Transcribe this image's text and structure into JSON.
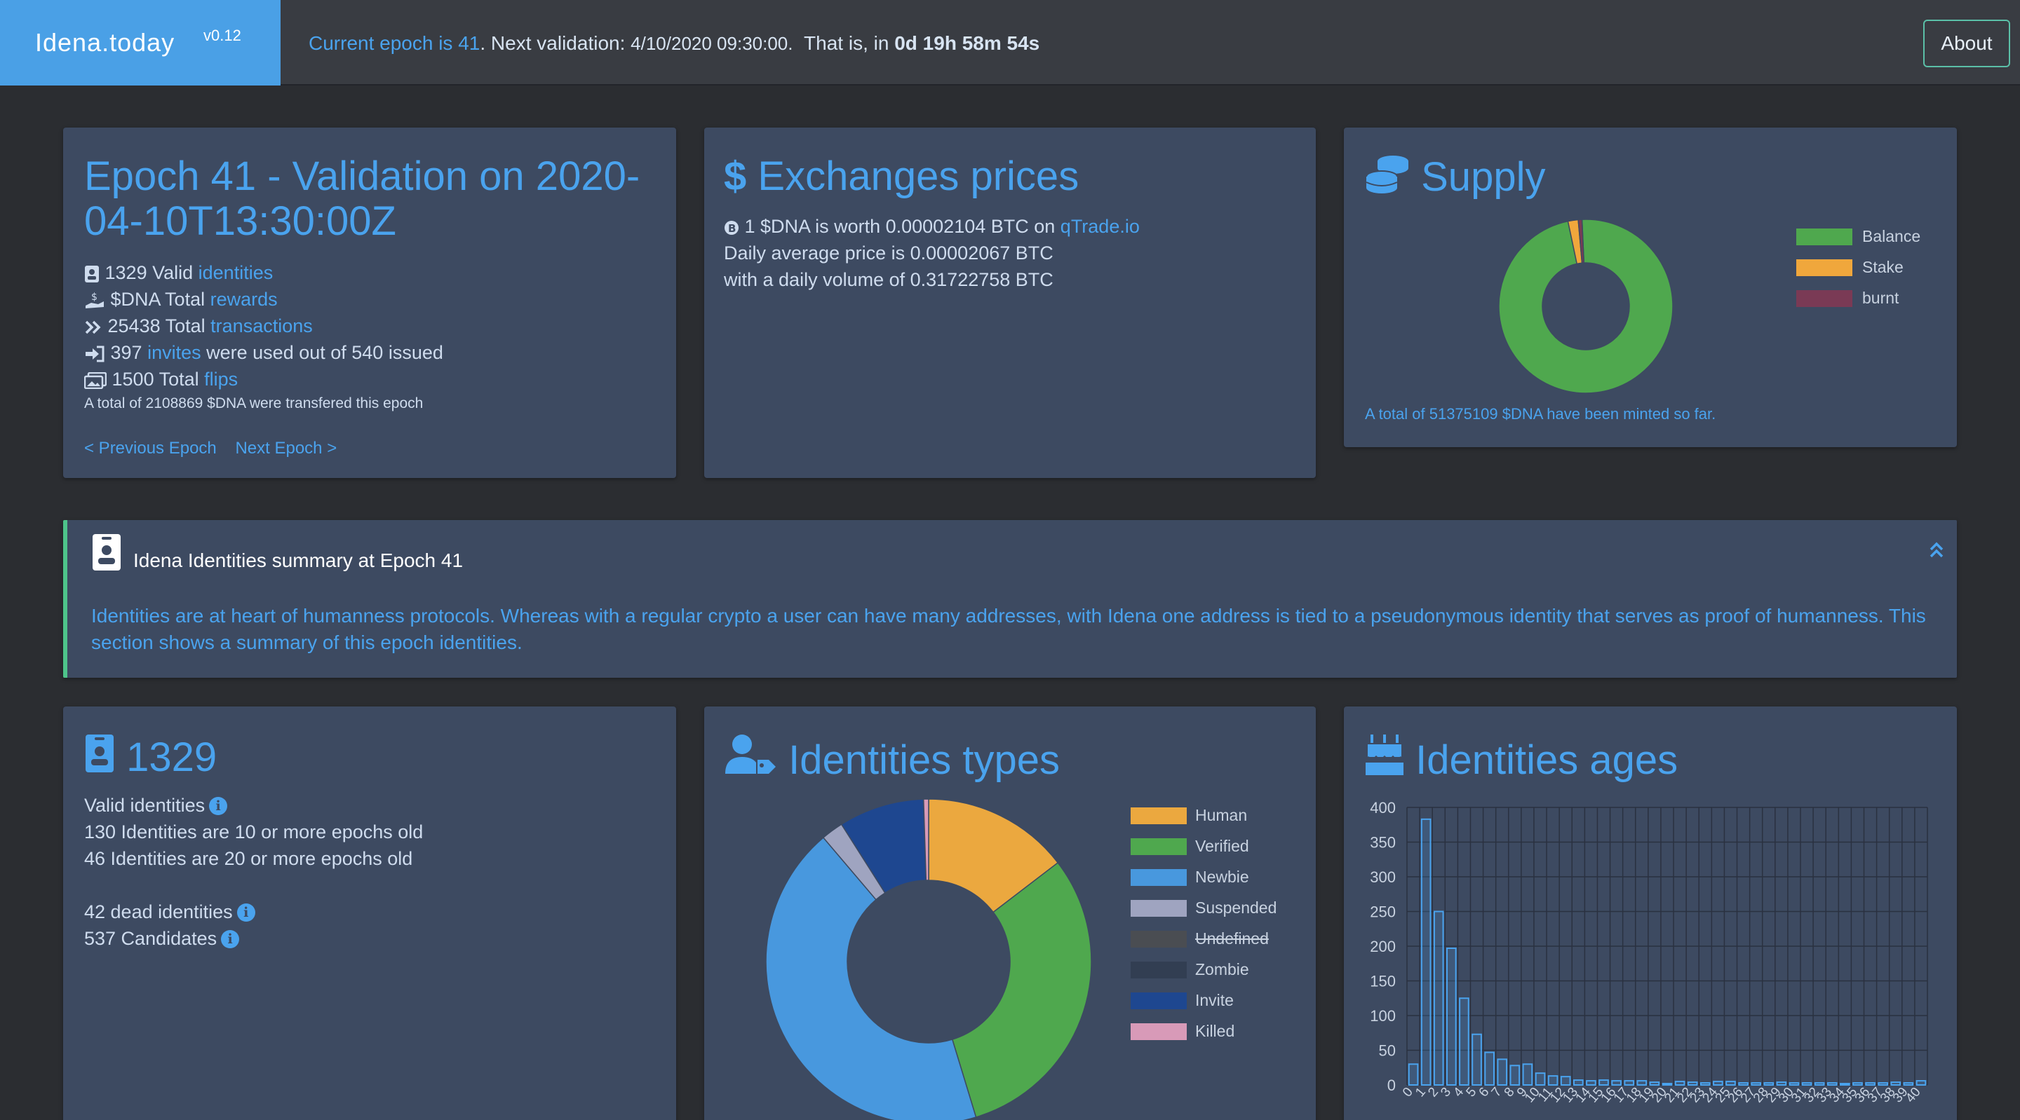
{
  "header": {
    "brand": "Idena.today",
    "version": "v0.12",
    "epoch_prefix": "Current epoch is",
    "epoch_number": "41",
    "next_validation_label": ". Next validation:",
    "next_validation_date": "4/10/2020 09:30:00.",
    "countdown_prefix": "That is, in",
    "countdown": "0d 19h 58m 54s",
    "about_label": "About"
  },
  "epoch_card": {
    "title": "Epoch 41 - Validation on 2020-04-10T13:30:00Z",
    "valid_count": "1329 Valid",
    "valid_link": "identities",
    "rewards_prefix": "$DNA Total",
    "rewards_link": "rewards",
    "tx_prefix": "25438 Total",
    "tx_link": "transactions",
    "invites_prefix": "397",
    "invites_link": "invites",
    "invites_suffix": "were used out of 540 issued",
    "flips_prefix": "1500 Total",
    "flips_link": "flips",
    "transferred": "A total of 2108869 $DNA were transfered this epoch",
    "prev_epoch": "< Previous Epoch",
    "next_epoch": "Next Epoch >"
  },
  "exchange_card": {
    "title": "Exchanges prices",
    "worth_prefix": "1 $DNA is worth 0.00002104 BTC on",
    "exchange_link": "qTrade.io",
    "daily_average": "Daily average price is 0.00002067 BTC",
    "daily_volume": "with a daily volume of 0.31722758 BTC"
  },
  "supply_card": {
    "title": "Supply",
    "minted": "A total of 51375109 $DNA have been minted so far.",
    "legend": [
      {
        "label": "Balance",
        "color": "#4fa84e"
      },
      {
        "label": "Stake",
        "color": "#f0a73c"
      },
      {
        "label": "burnt",
        "color": "#7a3a55"
      }
    ],
    "values": [
      97.4,
      1.9,
      0.7
    ]
  },
  "summary": {
    "title": "Idena Identities summary at Epoch 41",
    "text": "Identities are at heart of humanness protocols. Whereas with a regular crypto a user can have many addresses, with Idena one address is tied to a pseudonymous identity that serves as proof of humanness. This section shows a summary of this epoch identities."
  },
  "count_card": {
    "title": "1329",
    "valid": "Valid identities",
    "ten_epochs": "130 Identities are 10 or more epochs old",
    "twenty_epochs": "46 Identities are 20 or more epochs old",
    "dead": "42 dead identities",
    "candidates": "537 Candidates"
  },
  "types_card": {
    "title": "Identities types",
    "legend": [
      {
        "label": "Human",
        "color": "#eba83f"
      },
      {
        "label": "Verified",
        "color": "#4fa84e"
      },
      {
        "label": "Newbie",
        "color": "#4898de"
      },
      {
        "label": "Suspended",
        "color": "#9fa4c0"
      },
      {
        "label": "Undefined",
        "color": "#4a4d52"
      },
      {
        "label": "Zombie",
        "color": "#323e52"
      },
      {
        "label": "Invite",
        "color": "#1e4790"
      },
      {
        "label": "Killed",
        "color": "#d89ab8"
      }
    ],
    "values": [
      14.6,
      30.7,
      43.5,
      2.2,
      0,
      0,
      8.5,
      0.5
    ]
  },
  "ages_card": {
    "title": "Identities ages"
  },
  "chart_data": {
    "type": "bar",
    "categories": [
      "0",
      "1",
      "2",
      "3",
      "4",
      "5",
      "6",
      "7",
      "8",
      "9",
      "10",
      "11",
      "12",
      "13",
      "14",
      "15",
      "16",
      "17",
      "18",
      "19",
      "20",
      "21",
      "22",
      "23",
      "24",
      "25",
      "26",
      "27",
      "28",
      "29",
      "30",
      "31",
      "32",
      "33",
      "34",
      "35",
      "36",
      "37",
      "38",
      "39",
      "40"
    ],
    "values": [
      30,
      383,
      250,
      197,
      125,
      73,
      47,
      37,
      28,
      30,
      17,
      13,
      12,
      7,
      6,
      7,
      6,
      6,
      6,
      4,
      2,
      5,
      4,
      3,
      5,
      5,
      3,
      3,
      3,
      4,
      3,
      3,
      3,
      3,
      2,
      3,
      3,
      3,
      4,
      3,
      6
    ],
    "ylim": [
      0,
      400
    ],
    "yticks": [
      0,
      50,
      100,
      150,
      200,
      250,
      300,
      350,
      400
    ],
    "grid": true
  }
}
